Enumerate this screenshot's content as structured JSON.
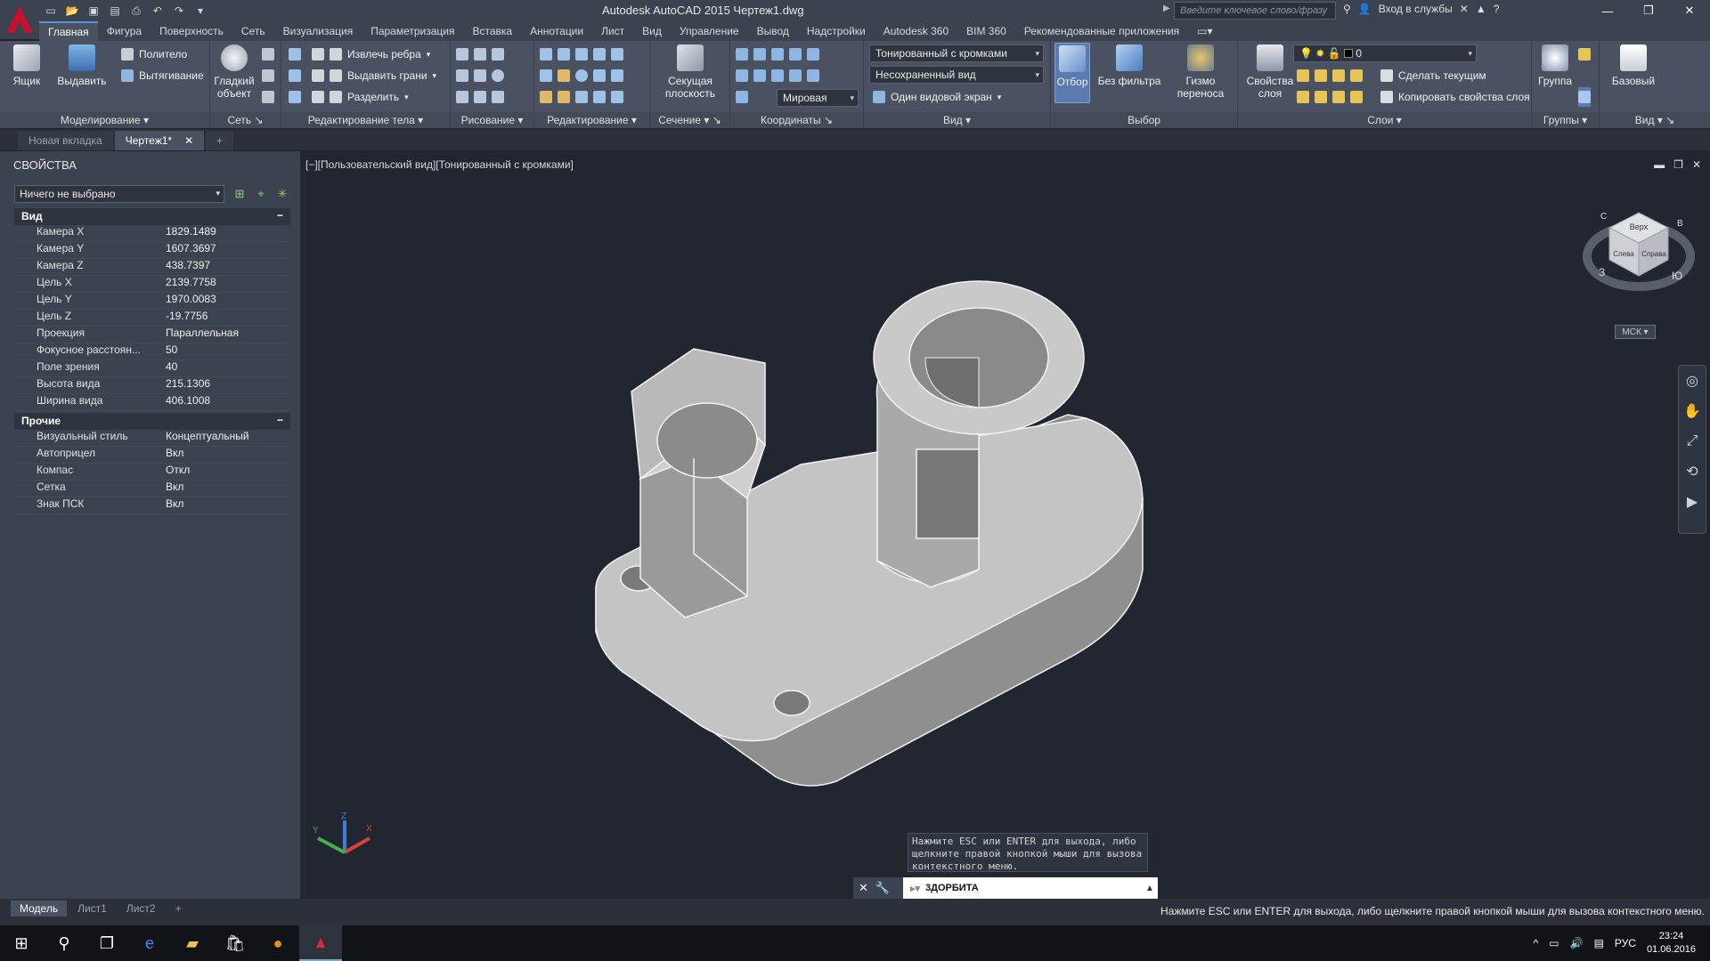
{
  "window": {
    "title": "Autodesk AutoCAD 2015    Чертеж1.dwg",
    "search_placeholder": "Введите ключевое слово/фразу",
    "signin": "Вход в службы"
  },
  "ribbon_tabs": [
    "Главная",
    "Фигура",
    "Поверхность",
    "Сеть",
    "Визуализация",
    "Параметризация",
    "Вставка",
    "Аннотации",
    "Лист",
    "Вид",
    "Управление",
    "Вывод",
    "Надстройки",
    "Autodesk 360",
    "BIM 360",
    "Рекомендованные приложения"
  ],
  "ribbon": {
    "modeling": {
      "label": "Моделирование",
      "box": "Ящик",
      "extrude": "Выдавить",
      "polysolid": "Политело",
      "presspull": "Вытягивание"
    },
    "mesh": {
      "label": "Сеть",
      "smooth": "Гладкий объект"
    },
    "solid_edit": {
      "label": "Редактирование тела",
      "extract_edges": "Извлечь ребра",
      "extrude_faces": "Выдавить грани",
      "separate": "Разделить"
    },
    "draw": {
      "label": "Рисование"
    },
    "modify": {
      "label": "Редактирование"
    },
    "section": {
      "label": "Сечение",
      "plane": "Секущая плоскость"
    },
    "coordinates": {
      "label": "Координаты",
      "world": "Мировая"
    },
    "view": {
      "label": "Вид",
      "visual_style": "Тонированный с кромками",
      "saved_view": "Несохраненный вид",
      "viewport": "Один видовой экран"
    },
    "selection": {
      "label": "Выбор",
      "culling": "Отбор",
      "no_filter": "Без фильтра",
      "gizmo": "Гизмо переноса"
    },
    "layers": {
      "label": "Слои",
      "layer_props": "Свойства слоя",
      "layer_value": "0",
      "make_current": "Сделать текущим",
      "match_layer": "Копировать свойства слоя"
    },
    "groups": {
      "label": "Группы",
      "group": "Группа"
    },
    "view2": {
      "label": "Вид",
      "base": "Базовый"
    }
  },
  "file_tabs": [
    {
      "label": "Новая вкладка"
    },
    {
      "label": "Чертеж1*"
    }
  ],
  "properties": {
    "title": "СВОЙСТВА",
    "selection": "Ничего не выбрано",
    "sections": [
      {
        "name": "Вид",
        "rows": [
          {
            "k": "Камера X",
            "v": "1829.1489"
          },
          {
            "k": "Камера Y",
            "v": "1607.3697"
          },
          {
            "k": "Камера Z",
            "v": "438.7397"
          },
          {
            "k": "Цель X",
            "v": "2139.7758"
          },
          {
            "k": "Цель Y",
            "v": "1970.0083"
          },
          {
            "k": "Цель Z",
            "v": "-19.7756"
          },
          {
            "k": "Проекция",
            "v": "Параллельная"
          },
          {
            "k": "Фокусное расстоян...",
            "v": "50"
          },
          {
            "k": "Поле зрения",
            "v": "40"
          },
          {
            "k": "Высота вида",
            "v": "215.1306"
          },
          {
            "k": "Ширина вида",
            "v": "406.1008"
          }
        ]
      },
      {
        "name": "Прочие",
        "rows": [
          {
            "k": "Визуальный стиль",
            "v": "Концептуальный"
          },
          {
            "k": "Автоприцел",
            "v": "Вкл"
          },
          {
            "k": "Компас",
            "v": "Откл"
          },
          {
            "k": "Сетка",
            "v": "Вкл"
          },
          {
            "k": "Знак ПСК",
            "v": "Вкл"
          }
        ]
      }
    ]
  },
  "viewport": {
    "label": "[−][Пользовательский вид][Тонированный с кромками]",
    "viewcube": {
      "top": "Верх",
      "front": "Слева",
      "right": "Справа",
      "compass_s": "Ю",
      "compass_w": "З",
      "compass_n": "С",
      "compass_e": "В"
    },
    "wcs": "МСК"
  },
  "command": {
    "hint": "Нажмите ESC или ENTER для выхода, либо щелкните правой кнопкой мыши для вызова контекстного меню.",
    "current": "3ДОРБИТА"
  },
  "layout_tabs": [
    "Модель",
    "Лист1",
    "Лист2"
  ],
  "status_text": "Нажмите ESC или ENTER для выхода, либо щелкните правой кнопкой мыши для вызова контекстного меню.",
  "taskbar": {
    "lang": "РУС",
    "time": "23:24",
    "date": "01.06.2016"
  }
}
